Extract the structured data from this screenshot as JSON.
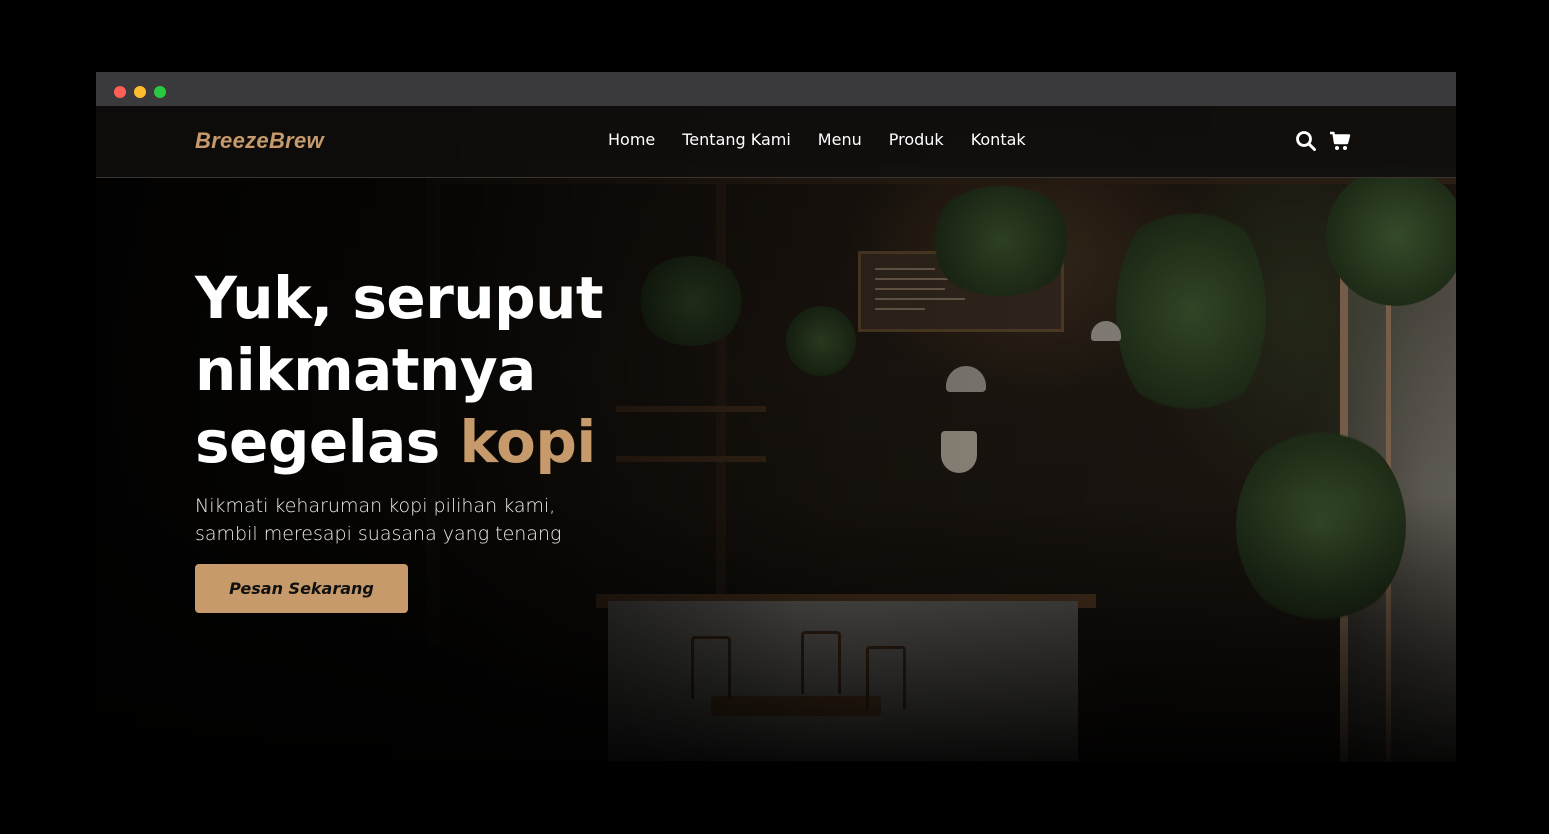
{
  "brand": {
    "logo": "BreezeBrew",
    "accent_color": "#c79a6b"
  },
  "nav": {
    "links": [
      {
        "label": "Home"
      },
      {
        "label": "Tentang Kami"
      },
      {
        "label": "Menu"
      },
      {
        "label": "Produk"
      },
      {
        "label": "Kontak"
      }
    ],
    "icons": [
      "search-icon",
      "shopping-cart-icon"
    ]
  },
  "hero": {
    "headline_line1": "Yuk, seruput",
    "headline_line2": "nikmatnya",
    "headline_line3_pre": "segelas",
    "headline_line3_accent": "kopi",
    "subtitle_line1": "Nikmati keharuman kopi pilihan kami,",
    "subtitle_line2": "sambil meresapi suasana yang tenang",
    "cta_label": "Pesan Sekarang"
  },
  "window_controls": [
    "close",
    "minimize",
    "maximize"
  ]
}
